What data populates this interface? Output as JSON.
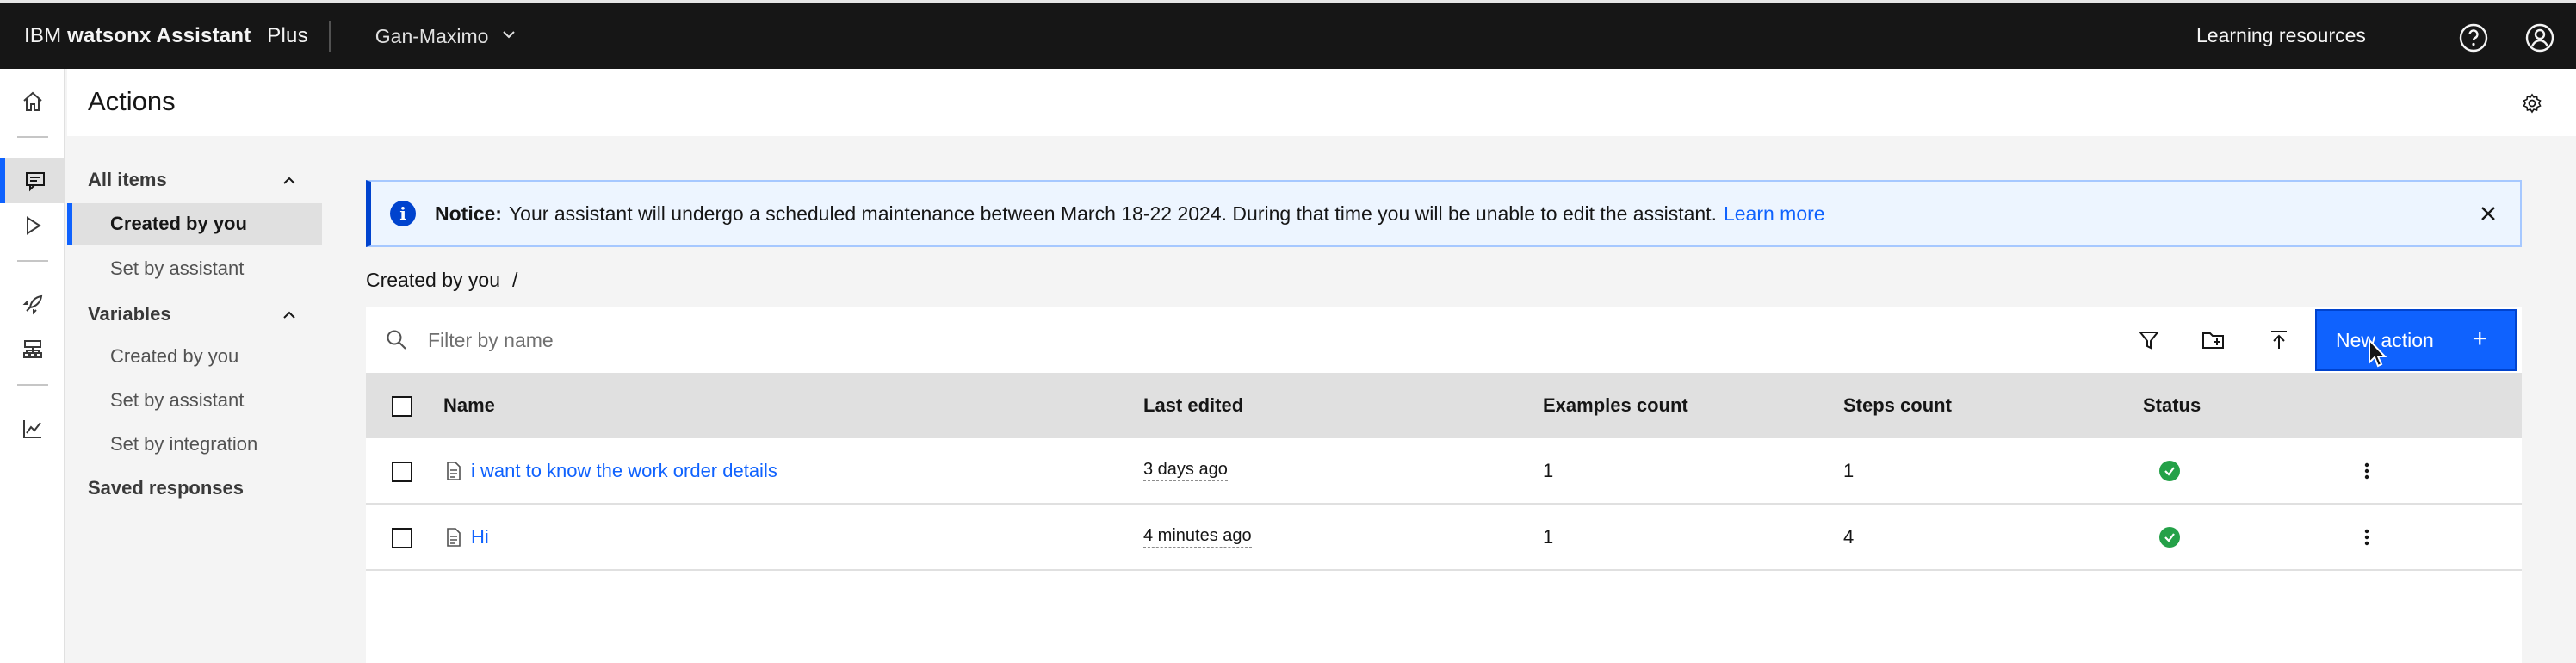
{
  "header": {
    "brand_prefix": "IBM",
    "brand_product": "watsonx Assistant",
    "brand_plan": "Plus",
    "instance": "Gan-Maximo",
    "learning_resources": "Learning resources",
    "icons": [
      "help-icon",
      "user-avatar-icon"
    ]
  },
  "page": {
    "title": "Actions"
  },
  "sidenav": {
    "all_items": "All items",
    "all_items_children": [
      "Created by you",
      "Set by assistant"
    ],
    "variables": "Variables",
    "variables_children": [
      "Created by you",
      "Set by assistant",
      "Set by integration"
    ],
    "saved_responses": "Saved responses",
    "selected": "Created by you"
  },
  "notice": {
    "title": "Notice:",
    "message": "Your assistant will undergo a scheduled maintenance between March 18-22 2024. During that time you will be unable to edit the assistant.",
    "link": "Learn more"
  },
  "breadcrumb": {
    "current": "Created by you",
    "separator": "/"
  },
  "toolbar": {
    "search_placeholder": "Filter by name",
    "new_action_label": "New action",
    "new_action_icon": "+"
  },
  "table": {
    "columns": [
      "Name",
      "Last edited",
      "Examples count",
      "Steps count",
      "Status"
    ],
    "rows": [
      {
        "name": "i want to know the work order details",
        "last_edited": "3 days ago",
        "examples": "1",
        "steps": "1",
        "status": "complete"
      },
      {
        "name": "Hi",
        "last_edited": "4 minutes ago",
        "examples": "1",
        "steps": "4",
        "status": "complete"
      }
    ]
  },
  "colors": {
    "accent": "#0f62fe",
    "topbar": "#161616",
    "success": "#24a148",
    "notice_bg": "#edf5ff"
  }
}
